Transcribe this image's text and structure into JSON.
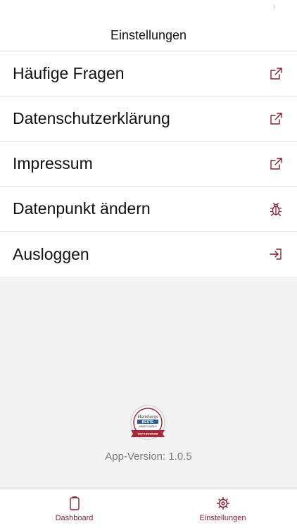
{
  "status_bar": {
    "indicator": "!"
  },
  "header": {
    "title": "Einstellungen"
  },
  "menu": {
    "items": [
      {
        "label": "Häufige Fragen",
        "icon": "external-link-icon"
      },
      {
        "label": "Datenschutzerklärung",
        "icon": "external-link-icon"
      },
      {
        "label": "Impressum",
        "icon": "external-link-icon"
      },
      {
        "label": "Datenpunkt ändern",
        "icon": "bug-icon"
      },
      {
        "label": "Ausloggen",
        "icon": "login-arrow-icon"
      }
    ]
  },
  "footer": {
    "badge_icon": "award-seal-icon",
    "badge_lettering": [
      "Hamburgs",
      "BESTE",
      "ARBEITGEBER",
      "WETTBEWERB"
    ],
    "app_version": "App-Version: 1.0.5"
  },
  "tab_bar": {
    "tabs": [
      {
        "label": "Dashboard",
        "icon": "clipboard-icon"
      },
      {
        "label": "Einstellungen",
        "icon": "gear-icon"
      }
    ]
  },
  "colors": {
    "accent": "#8a1e2e",
    "background": "#f2f2f2",
    "surface": "#ffffff"
  }
}
